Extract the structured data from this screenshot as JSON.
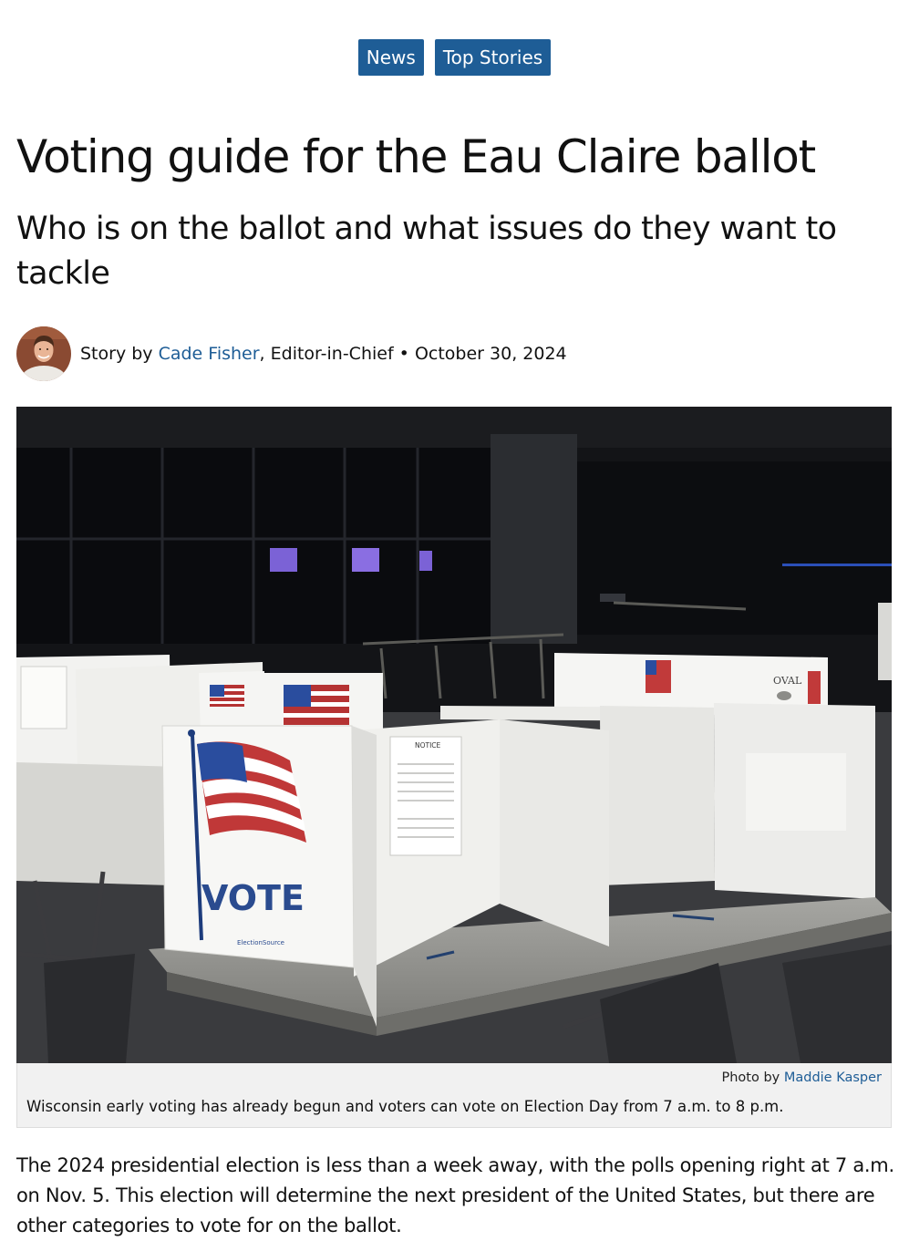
{
  "categories": [
    "News",
    "Top Stories"
  ],
  "headline": "Voting guide for the Eau Claire ballot",
  "deck": "Who is on the ballot and what issues do they want to tackle",
  "byline": {
    "prefix": "Story by ",
    "author": "Cade Fisher",
    "role": ", Editor-in-Chief",
    "separator": " • ",
    "date": "October 30, 2024"
  },
  "photo": {
    "credit_prefix": "Photo by ",
    "credit_name": "Maddie Kasper",
    "caption": "Wisconsin early voting has already begun and voters can vote on Election Day from 7 a.m. to 8 p.m.",
    "signage": {
      "vote": "VOTE",
      "oval": "OVAL",
      "notice": "NOTICE",
      "brand": "ElectionSource"
    }
  },
  "body": {
    "paragraph_1": "The 2024 presidential election is less than a week away, with the polls opening right at 7 a.m. on Nov. 5. This election will determine the next president of the United States, but there are other categories to vote for on the ballot."
  },
  "colors": {
    "accent": "#1e5d96",
    "caption_bg": "#f1f1f1",
    "text": "#111111"
  }
}
